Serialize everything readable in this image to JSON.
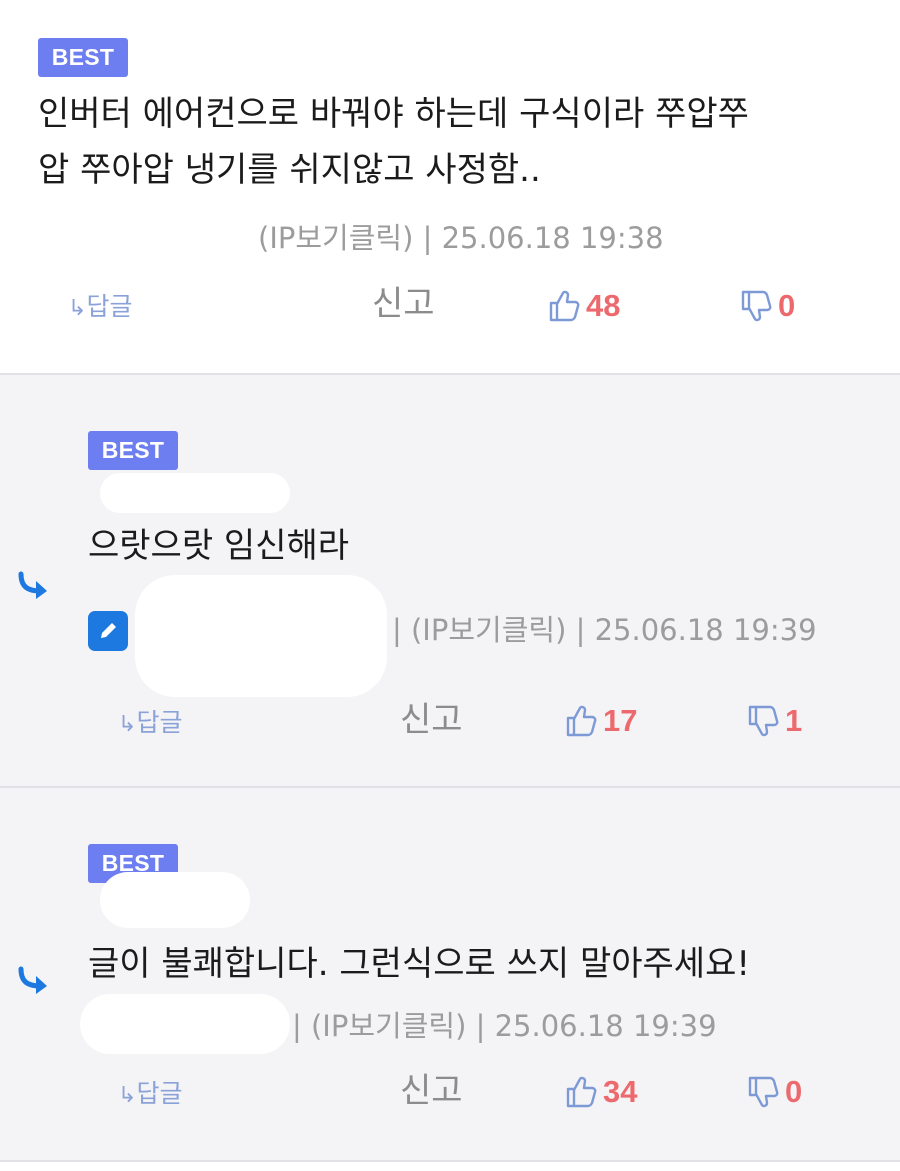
{
  "comments": [
    {
      "badge": "BEST",
      "text_lines": [
        "인버터 에어컨으로 바꿔야 하는데 구식이라 쭈압쭈",
        "압 쭈아압 냉기를 쉬지않고 사정함.."
      ],
      "meta": "(IP보기클릭) | 25.06.18 19:38",
      "reply_label": "답글",
      "report_label": "신고",
      "likes": "48",
      "dislikes": "0"
    },
    {
      "badge": "BEST",
      "text_lines": [
        "으랏으랏 임신해라"
      ],
      "meta": "| (IP보기클릭) | 25.06.18 19:39",
      "reply_label": "답글",
      "report_label": "신고",
      "likes": "17",
      "dislikes": "1"
    },
    {
      "badge": "BEST",
      "text_lines": [
        "글이 불쾌합니다. 그런식으로 쓰지 말아주세요!"
      ],
      "meta": "| (IP보기클릭) | 25.06.18 19:39",
      "reply_label": "답글",
      "report_label": "신고",
      "likes": "34",
      "dislikes": "0"
    }
  ],
  "icons": {
    "reply_arrow": "reply-arrow-icon",
    "thumbs_up": "thumbs-up-icon",
    "thumbs_down": "thumbs-down-icon",
    "edit": "pencil-icon",
    "nested_reply": "nested-reply-arrow-icon"
  },
  "colors": {
    "badge": "#6d7ef0",
    "count": "#ec6a6e",
    "reply_link": "#8aa2d8",
    "thumb_icon": "#7e9ad6",
    "nested_arrow": "#1d78e0",
    "reply_bg": "#f4f4f6"
  }
}
